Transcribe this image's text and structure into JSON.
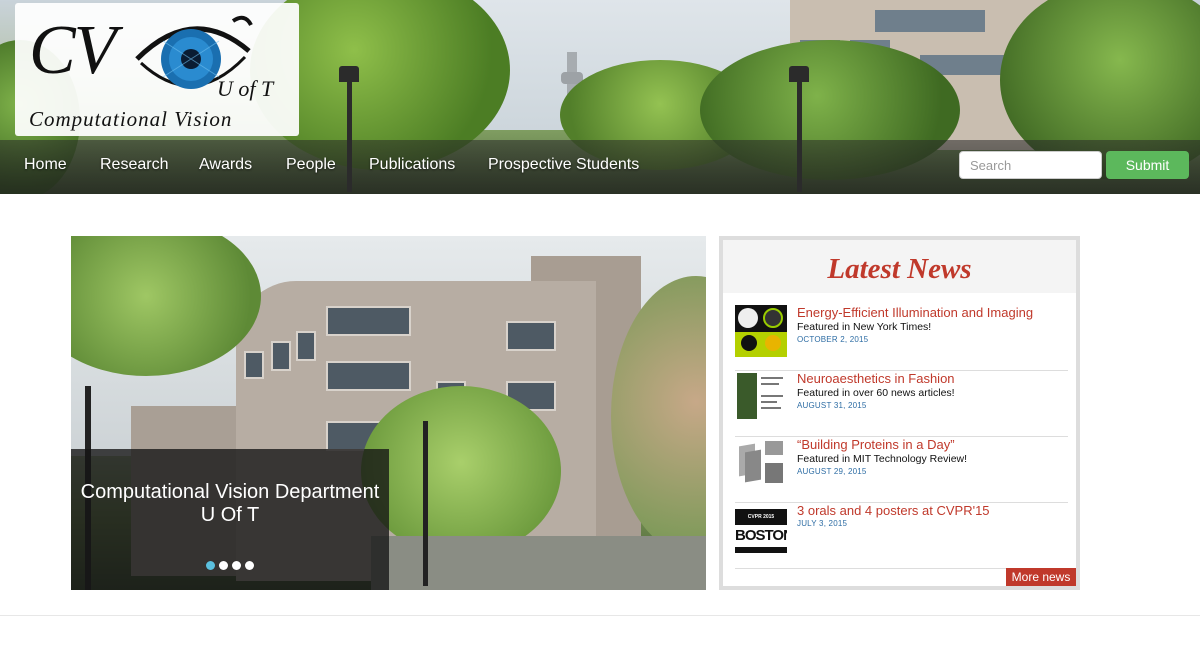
{
  "logo": {
    "cv": "CV",
    "uoft": "U of T",
    "subtitle": "Computational Vision"
  },
  "nav": {
    "items": [
      "Home",
      "Research",
      "Awards",
      "People",
      "Publications",
      "Prospective Students"
    ]
  },
  "search": {
    "placeholder": "Search",
    "submit_label": "Submit"
  },
  "carousel": {
    "caption": "Computational Vision Department U Of T",
    "slide_count": 4,
    "active_slide": 1
  },
  "news": {
    "title": "Latest News",
    "items": [
      {
        "headline": "Energy-Efficient Illumination and Imaging",
        "subtitle": "Featured in New York Times!",
        "date": "OCTOBER 2, 2015"
      },
      {
        "headline": "Neuroaesthetics in Fashion",
        "subtitle": "Featured in over 60 news articles!",
        "date": "AUGUST 31, 2015"
      },
      {
        "headline": "“Building Proteins in a Day”",
        "subtitle": "Featured in MIT Technology Review!",
        "date": "AUGUST 29, 2015"
      },
      {
        "headline": "3 orals and 4 posters at CVPR'15",
        "subtitle": "",
        "date": "JULY 3, 2015",
        "thumb_text_top": "CVPR 2015",
        "thumb_text_main": "BOSTON"
      }
    ],
    "more_label": "More news"
  },
  "colors": {
    "accent_red": "#c0392b",
    "submit_green": "#5cb85c",
    "date_blue": "#2e6da4",
    "dot_active": "#5bc0de"
  }
}
